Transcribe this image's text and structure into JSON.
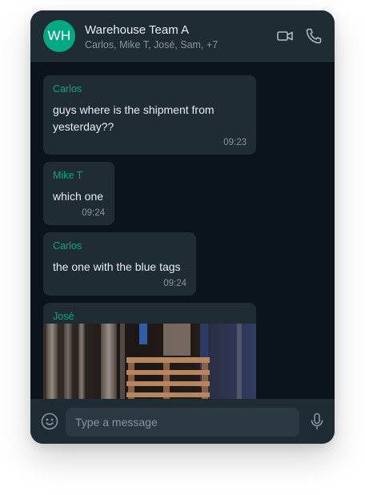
{
  "chat": {
    "avatar_initials": "WH",
    "title": "Warehouse Team A",
    "members": "Carlos, Mike T, José, Sam, +7",
    "icons": {
      "video": "video-camera-icon",
      "call": "phone-icon"
    }
  },
  "messages": [
    {
      "sender": "Carlos",
      "text": "guys where is the shipment from yesterday??",
      "time": "09:23"
    },
    {
      "sender": "Mike T",
      "text": "which one",
      "time": "09:24"
    },
    {
      "sender": "Carlos",
      "text": "the one with the blue tags",
      "time": "09:24"
    },
    {
      "sender": "José",
      "attachment": "warehouse pallets photo"
    }
  ],
  "composer": {
    "placeholder": "Type a message",
    "icons": {
      "emoji": "emoji-icon",
      "mic": "microphone-icon"
    }
  },
  "colors": {
    "accent": "#00a884",
    "header_bg": "#1f2c34",
    "chat_bg": "#0b141a",
    "bubble_bg": "#202c33",
    "input_bg": "#2a3942",
    "text_primary": "#e9edef",
    "text_secondary": "#8696a0"
  }
}
